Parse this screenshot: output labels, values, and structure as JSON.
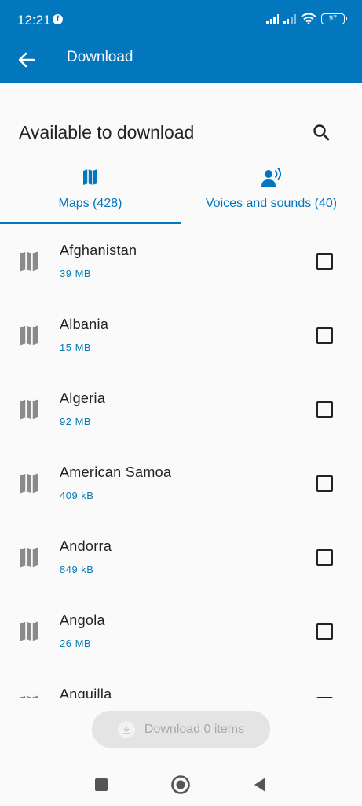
{
  "status_bar": {
    "time": "12:21",
    "notification_glyph": "f",
    "battery_level": "97"
  },
  "app_bar": {
    "title": "Download"
  },
  "header": {
    "title": "Available to download"
  },
  "tabs": [
    {
      "label": "Maps (428)",
      "icon": "map-icon",
      "selected": true
    },
    {
      "label": "Voices and sounds (40)",
      "icon": "voice-icon",
      "selected": false
    }
  ],
  "items": [
    {
      "name": "Afghanistan",
      "size": "39 MB",
      "checked": false
    },
    {
      "name": "Albania",
      "size": "15 MB",
      "checked": false
    },
    {
      "name": "Algeria",
      "size": "92 MB",
      "checked": false
    },
    {
      "name": "American Samoa",
      "size": "409 kB",
      "checked": false
    },
    {
      "name": "Andorra",
      "size": "849 kB",
      "checked": false
    },
    {
      "name": "Angola",
      "size": "26 MB",
      "checked": false
    },
    {
      "name": "Anguilla",
      "size": "",
      "checked": false
    }
  ],
  "download_button": {
    "label": "Download 0 items"
  },
  "colors": {
    "primary": "#0277bd",
    "size_text": "#0a7bb0",
    "disabled_bg": "#e4e4e4"
  }
}
